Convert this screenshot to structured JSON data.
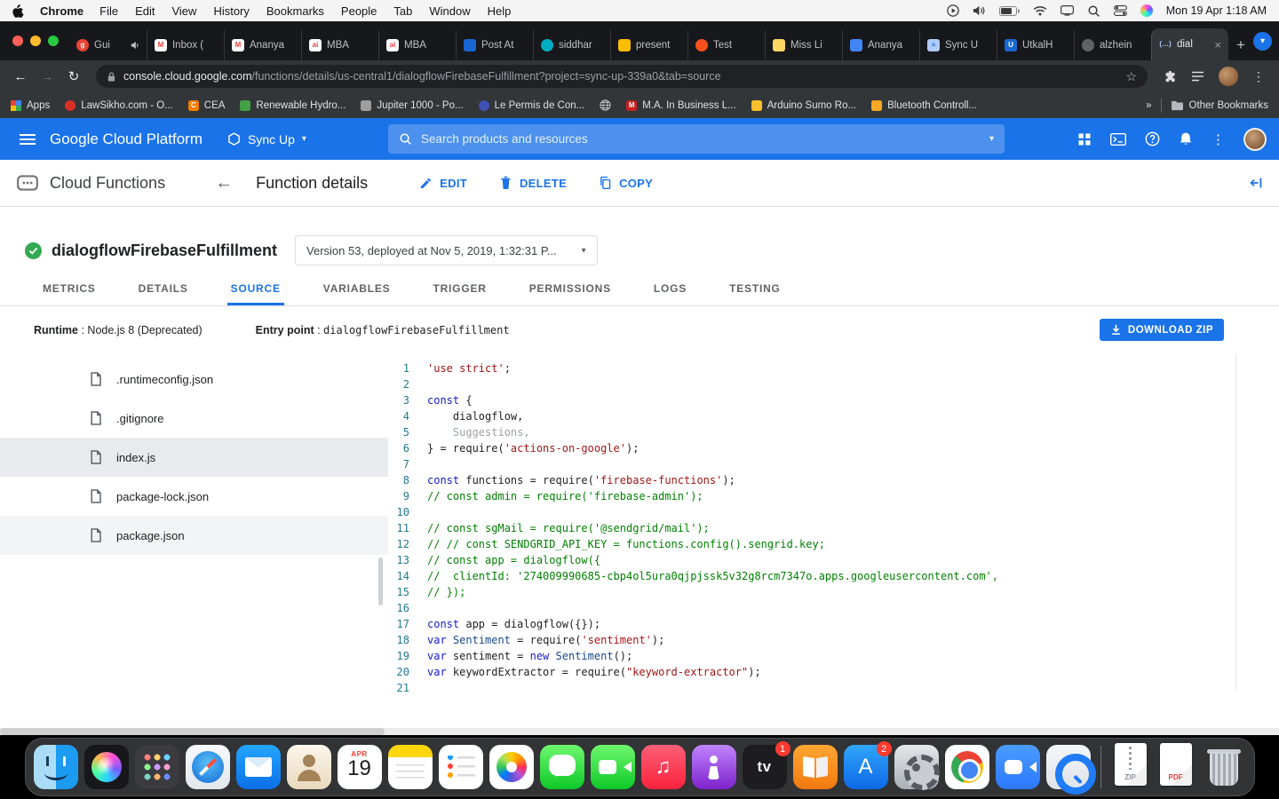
{
  "colors": {
    "accent": "#1a73e8",
    "gcp_header": "#1a73e8",
    "status_green": "#34a853",
    "code": {
      "kw": "#1518c8",
      "str": "#a31515",
      "com": "#008000",
      "ln": "#237893",
      "pln": "#1f1f1f",
      "dim": "#9aa0a6",
      "cls": "#16498c"
    }
  },
  "menubar": {
    "app_name": "Chrome",
    "menus": [
      "File",
      "Edit",
      "View",
      "History",
      "Bookmarks",
      "People",
      "Tab",
      "Window",
      "Help"
    ],
    "status_icons": [
      "play-circle",
      "volume",
      "battery",
      "wifi",
      "display",
      "magnifier",
      "control-center",
      "siri"
    ],
    "clock": "Mon 19 Apr  1:18 AM"
  },
  "browser": {
    "new_tab_glyph": "+",
    "close_glyph": "×",
    "tab_search_glyph": "▾",
    "tabs": [
      {
        "title": "Gui",
        "fav": {
          "bg": "#ea4335",
          "glyph": "g",
          "fg": "#ffffff",
          "shape": "round"
        },
        "audio": true
      },
      {
        "title": "Inbox (",
        "fav": {
          "bg": "#ffffff",
          "glyph": "M",
          "fg": "#ea4335"
        }
      },
      {
        "title": "Ananya",
        "fav": {
          "bg": "#ffffff",
          "glyph": "M",
          "fg": "#ea4335"
        }
      },
      {
        "title": "MBA",
        "fav": {
          "bg": "#ffffff",
          "glyph": "ai",
          "fg": "#e4434b"
        }
      },
      {
        "title": "MBA",
        "fav": {
          "bg": "#ffffff",
          "glyph": "ai",
          "fg": "#e4434b"
        }
      },
      {
        "title": "Post At",
        "fav": {
          "bg": "#1967d2"
        }
      },
      {
        "title": "siddhar",
        "fav": {
          "bg": "#00acc1",
          "shape": "round"
        }
      },
      {
        "title": "present",
        "fav": {
          "bg": "#fbbc04"
        }
      },
      {
        "title": "Test",
        "fav": {
          "bg": "#f4511e",
          "shape": "round"
        }
      },
      {
        "title": "Miss Li",
        "fav": {
          "bg": "#fdd663"
        }
      },
      {
        "title": "Ananya",
        "fav": {
          "bg": "#4285f4"
        }
      },
      {
        "title": "Sync U",
        "fav": {
          "bg": "#aecbfa",
          "glyph": "≡",
          "fg": "#1967d2"
        }
      },
      {
        "title": "UtkalH",
        "fav": {
          "bg": "#1967d2",
          "glyph": "U",
          "fg": "#ffffff"
        }
      },
      {
        "title": "alzhein",
        "fav": {
          "bg": "#5f6368",
          "shape": "round"
        }
      },
      {
        "title": "dial",
        "fav": {
          "bg": "transparent",
          "glyph": "(…)",
          "fg": "#aecbfa"
        },
        "active": true,
        "close": true
      }
    ]
  },
  "address": {
    "back": "←",
    "forward": "→",
    "reload": "↻",
    "domain": "console.cloud.google.com",
    "path": "/functions/details/us-central1/dialogflowFirebaseFulfillment?project=sync-up-339a0&tab=source",
    "star": "☆",
    "dots": "⋮"
  },
  "bookmarks": {
    "items": [
      {
        "label": "Apps",
        "icon": "apps-grid"
      },
      {
        "label": "LawSikho.com - O...",
        "fav": {
          "bg": "#d93025",
          "shape": "round"
        }
      },
      {
        "label": "CEA",
        "fav": {
          "bg": "#f57c00",
          "glyph": "C",
          "fg": "#ffffff"
        }
      },
      {
        "label": "Renewable Hydro...",
        "fav": {
          "bg": "#43a047"
        }
      },
      {
        "label": "Jupiter 1000 - Po...",
        "fav": {
          "bg": "#9e9e9e"
        }
      },
      {
        "label": "Le Permis de Con...",
        "fav": {
          "bg": "#3f51b5",
          "shape": "round"
        }
      },
      {
        "label": "",
        "icon": "globe"
      },
      {
        "label": "M.A. In Business L...",
        "fav": {
          "bg": "#c5221f",
          "glyph": "M",
          "fg": "#ffffff"
        }
      },
      {
        "label": "Arduino Sumo Ro...",
        "fav": {
          "bg": "#fbc02d"
        }
      },
      {
        "label": "Bluetooth Controll...",
        "fav": {
          "bg": "#f9a825"
        }
      }
    ],
    "overflow": "»",
    "other_label": "Other Bookmarks"
  },
  "gcp": {
    "brand": "Google Cloud Platform",
    "project": "Sync Up",
    "caret": "▾",
    "search_placeholder": "Search products and resources",
    "dots_glyph": "⋮",
    "header_icons": [
      "grid4",
      "terminal",
      "help",
      "bell",
      "dots",
      "avatar"
    ]
  },
  "page": {
    "product": "Cloud Functions",
    "back": "←",
    "title": "Function details",
    "actions": [
      {
        "icon": "pencil",
        "label": "EDIT"
      },
      {
        "icon": "trash",
        "label": "DELETE"
      },
      {
        "icon": "copy",
        "label": "COPY"
      }
    ]
  },
  "fn": {
    "name": "dialogflowFirebaseFulfillment",
    "version": "Version 53, deployed at Nov 5, 2019, 1:32:31 P...",
    "caret": "▾"
  },
  "tabs": {
    "items": [
      "METRICS",
      "DETAILS",
      "SOURCE",
      "VARIABLES",
      "TRIGGER",
      "PERMISSIONS",
      "LOGS",
      "TESTING"
    ],
    "active_index": 2
  },
  "meta": {
    "runtime_label": "Runtime",
    "runtime_rest": " : Node.js 8 (Deprecated)",
    "entry_label": "Entry point",
    "entry_sep": " : ",
    "entry_value": "dialogflowFirebaseFulfillment",
    "download_label": "DOWNLOAD ZIP"
  },
  "files": {
    "items": [
      {
        "name": ".runtimeconfig.json"
      },
      {
        "name": ".gitignore"
      },
      {
        "name": "index.js",
        "state": "selected"
      },
      {
        "name": "package-lock.json"
      },
      {
        "name": "package.json",
        "state": "shaded"
      }
    ]
  },
  "code": {
    "lines": [
      [
        [
          "str",
          "'use strict'"
        ],
        [
          "pln",
          ";"
        ]
      ],
      [],
      [
        [
          "kw",
          "const"
        ],
        [
          "pln",
          " {"
        ]
      ],
      [
        [
          "pln",
          "    dialogflow,"
        ]
      ],
      [
        [
          "dim",
          "    Suggestions,"
        ]
      ],
      [
        [
          "pln",
          "} = require("
        ],
        [
          "str",
          "'actions-on-google'"
        ],
        [
          "pln",
          ");"
        ]
      ],
      [],
      [
        [
          "kw",
          "const"
        ],
        [
          "pln",
          " functions = require("
        ],
        [
          "str",
          "'firebase-functions'"
        ],
        [
          "pln",
          ");"
        ]
      ],
      [
        [
          "com",
          "// const admin = require('firebase-admin');"
        ]
      ],
      [],
      [
        [
          "com",
          "// const sgMail = require('@sendgrid/mail');"
        ]
      ],
      [
        [
          "com",
          "// // const SENDGRID_API_KEY = functions.config().sengrid.key;"
        ]
      ],
      [
        [
          "com",
          "// const app = dialogflow({"
        ]
      ],
      [
        [
          "com",
          "//  clientId: '274009990685-cbp4ol5ura0qjpjssk5v32g8rcm7347o.apps.googleusercontent.com',"
        ]
      ],
      [
        [
          "com",
          "// });"
        ]
      ],
      [],
      [
        [
          "kw",
          "const"
        ],
        [
          "pln",
          " app = dialogflow({});"
        ]
      ],
      [
        [
          "kw",
          "var"
        ],
        [
          "pln",
          " "
        ],
        [
          "cls",
          "Sentiment"
        ],
        [
          "pln",
          " = require("
        ],
        [
          "str",
          "'sentiment'"
        ],
        [
          "pln",
          ");"
        ]
      ],
      [
        [
          "kw",
          "var"
        ],
        [
          "pln",
          " sentiment = "
        ],
        [
          "kw",
          "new"
        ],
        [
          "pln",
          " "
        ],
        [
          "cls",
          "Sentiment"
        ],
        [
          "pln",
          "();"
        ]
      ],
      [
        [
          "kw",
          "var"
        ],
        [
          "pln",
          " keywordExtractor = require("
        ],
        [
          "str",
          "\"keyword-extractor\""
        ],
        [
          "pln",
          ");"
        ]
      ],
      []
    ]
  },
  "dock": {
    "items": [
      {
        "id": "finder"
      },
      {
        "id": "siri"
      },
      {
        "id": "launchpad"
      },
      {
        "id": "safari"
      },
      {
        "id": "mail"
      },
      {
        "id": "contacts"
      },
      {
        "id": "calendar",
        "month": "APR",
        "day": "19"
      },
      {
        "id": "notes"
      },
      {
        "id": "reminders"
      },
      {
        "id": "photos"
      },
      {
        "id": "messages"
      },
      {
        "id": "facetime"
      },
      {
        "id": "music",
        "glyph": "♫"
      },
      {
        "id": "podcasts"
      },
      {
        "id": "tv",
        "glyph": "tv",
        "badge": "1"
      },
      {
        "id": "books"
      },
      {
        "id": "appstore",
        "glyph": "A",
        "badge": "2"
      },
      {
        "id": "settings"
      },
      {
        "id": "chrome"
      },
      {
        "id": "zoom"
      },
      {
        "id": "quicktime"
      },
      {
        "id": "separator"
      },
      {
        "id": "zip",
        "label": "ZIP"
      },
      {
        "id": "pdf",
        "label": "PDF"
      },
      {
        "id": "trash"
      }
    ]
  }
}
